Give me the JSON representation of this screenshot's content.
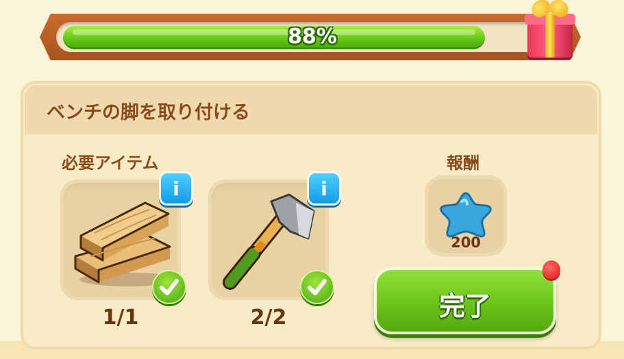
{
  "progress": {
    "percent": 88,
    "label": "88%"
  },
  "task": {
    "title": "ベンチの脚を取り付ける"
  },
  "required": {
    "heading": "必要アイテム",
    "items": [
      {
        "icon": "wood-planks-icon",
        "count": "1/1",
        "info_label": "i"
      },
      {
        "icon": "axe-icon",
        "count": "2/2",
        "info_label": "i"
      }
    ]
  },
  "reward": {
    "heading": "報酬",
    "icon": "blue-star-icon",
    "amount": "200"
  },
  "complete_button": {
    "label": "完了"
  },
  "colors": {
    "progress_fill": "#5fc414",
    "frame": "#c96b2a",
    "info_button": "#139bea",
    "complete_button": "#6cc41b",
    "notify": "#e01212",
    "star": "#3aa7df"
  }
}
